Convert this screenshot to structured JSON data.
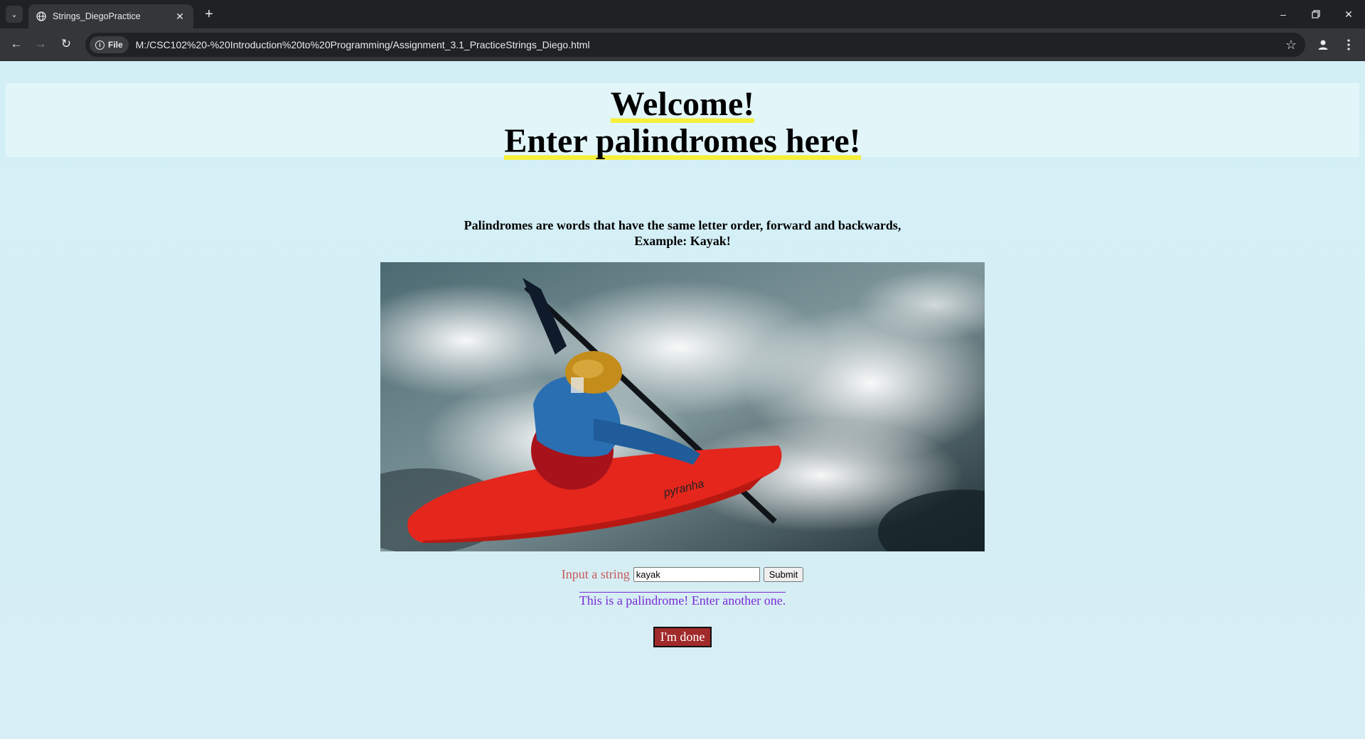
{
  "browser": {
    "tab_title": "Strings_DiegoPractice",
    "url_chip": "File",
    "url": "M:/CSC102%20-%20Introduction%20to%20Programming/Assignment_3.1_PracticeStrings_Diego.html"
  },
  "page": {
    "heading_line1": "Welcome!",
    "heading_line2": "Enter palindromes here!",
    "intro_line1": "Palindromes are words that have the same letter order, forward and backwards,",
    "intro_line2": "Example: Kayak!",
    "image_brand_text": "pyranha",
    "form": {
      "label": "Input a string",
      "input_value": "kayak",
      "submit_label": "Submit"
    },
    "result_text": "This is a palindrome! Enter another one.",
    "done_label": "I'm done"
  },
  "colors": {
    "page_bg": "#d3eff5",
    "header_band": "#e2f6fa",
    "heading_highlight": "#f5ef3a",
    "form_label": "#c85a5a",
    "result_text": "#7b2bd6",
    "done_button": "#a12a2a"
  }
}
